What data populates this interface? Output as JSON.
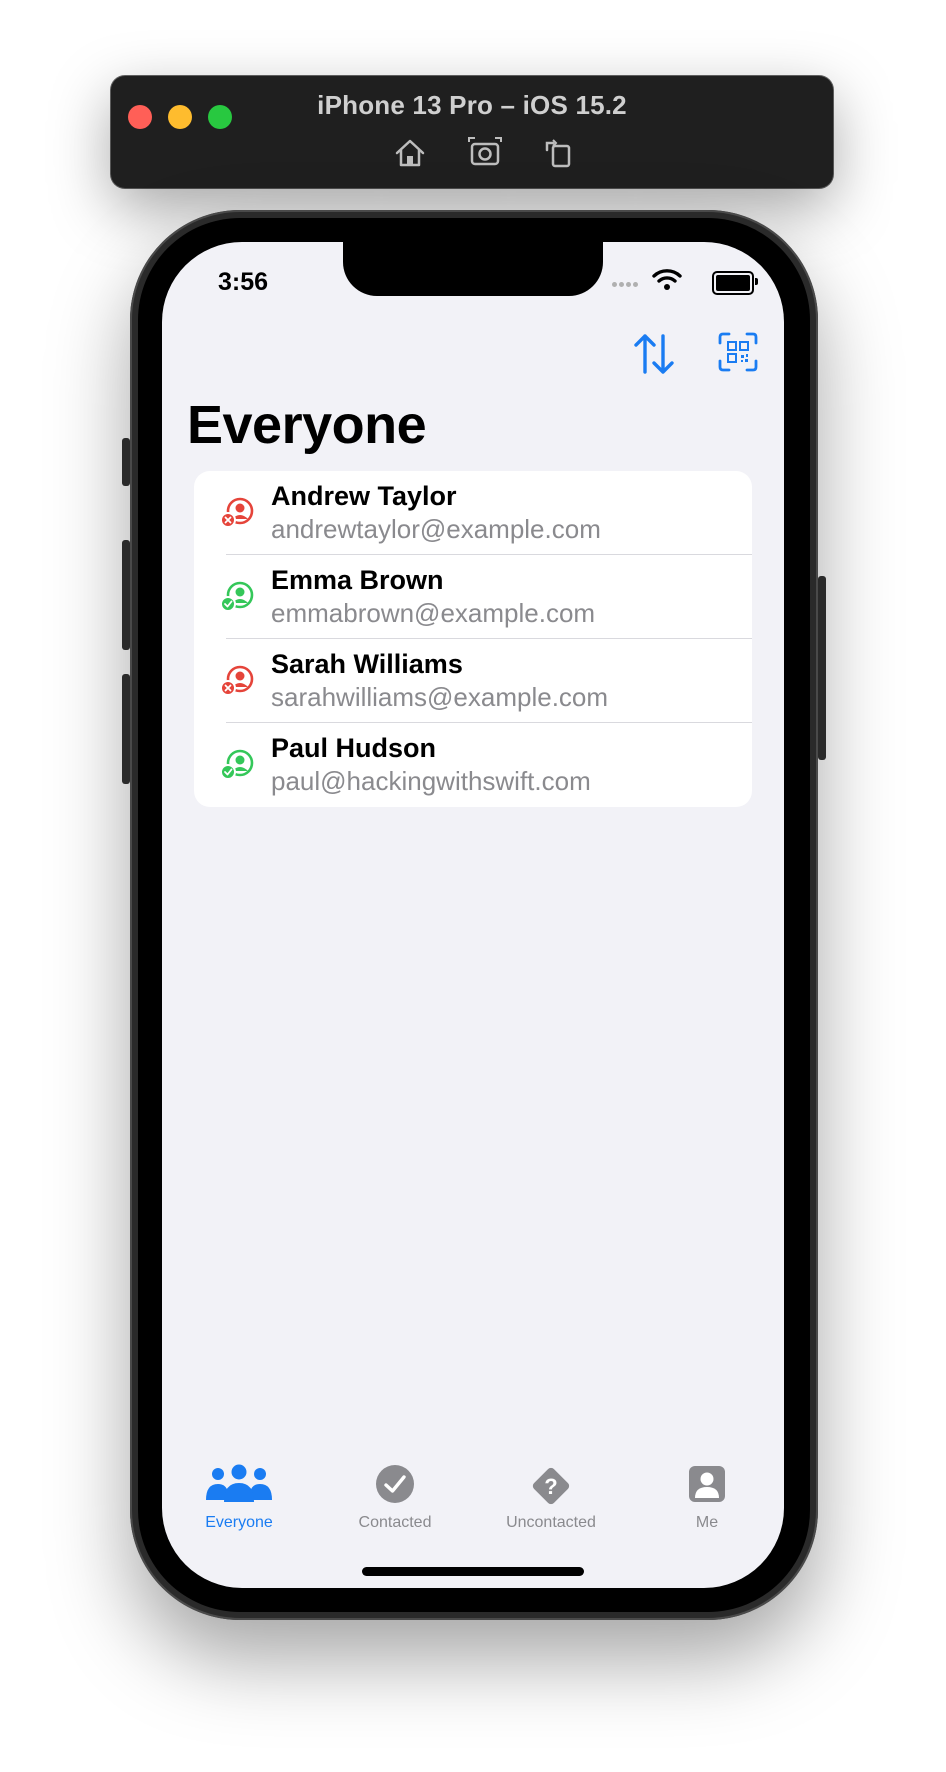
{
  "simulator": {
    "title": "iPhone 13 Pro – iOS 15.2",
    "tools": [
      "home-icon",
      "screenshot-icon",
      "rotate-icon"
    ]
  },
  "status_bar": {
    "time": "3:56"
  },
  "nav": {
    "sort_icon": "arrow-up-down-icon",
    "scan_icon": "qr-scan-icon"
  },
  "page": {
    "title": "Everyone"
  },
  "colors": {
    "accent": "#1a7cf2",
    "uncontacted": "#e5443a",
    "contacted": "#34c759",
    "secondary_text": "#8a8a8e"
  },
  "contacts": [
    {
      "name": "Andrew Taylor",
      "email": "andrewtaylor@example.com",
      "status": "uncontacted"
    },
    {
      "name": "Emma Brown",
      "email": "emmabrown@example.com",
      "status": "contacted"
    },
    {
      "name": "Sarah Williams",
      "email": "sarahwilliams@example.com",
      "status": "uncontacted"
    },
    {
      "name": "Paul Hudson",
      "email": "paul@hackingwithswift.com",
      "status": "contacted"
    }
  ],
  "tabs": [
    {
      "label": "Everyone",
      "icon": "people-icon",
      "active": true
    },
    {
      "label": "Contacted",
      "icon": "checkmark-circle-icon",
      "active": false
    },
    {
      "label": "Uncontacted",
      "icon": "questionmark-diamond-icon",
      "active": false
    },
    {
      "label": "Me",
      "icon": "person-square-icon",
      "active": false
    }
  ]
}
